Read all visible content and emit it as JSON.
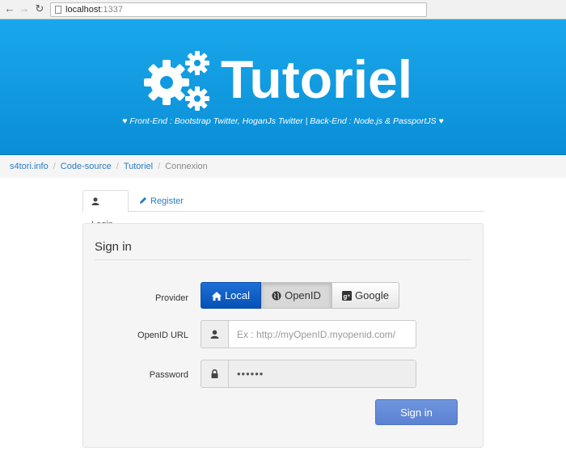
{
  "browser": {
    "url_host": "localhost",
    "url_port": ":1337"
  },
  "banner": {
    "brand": "Tutoriel",
    "tagline": "♥ Front-End : Bootstrap Twitter, HoganJs Twitter | Back-End : Node.js & PassportJS ♥",
    "bg_color": "#0e99e0"
  },
  "breadcrumb": {
    "items": [
      "s4tori.info",
      "Code-source",
      "Tutoriel"
    ],
    "active": "Connexion",
    "separator": "/"
  },
  "tabs": {
    "login": "Login",
    "register": "Register"
  },
  "form": {
    "legend": "Sign in",
    "provider_label": "Provider",
    "providers": [
      "Local",
      "OpenID",
      "Google"
    ],
    "selected_provider": "Local",
    "openid_label": "OpenID URL",
    "openid_placeholder": "Ex : http://myOpenID.myopenid.com/",
    "password_label": "Password",
    "password_value": "••••••",
    "submit_label": "Sign in"
  },
  "colors": {
    "accent": "#0652b5",
    "link": "#2a7bc0",
    "submit": "#5a82d2"
  }
}
